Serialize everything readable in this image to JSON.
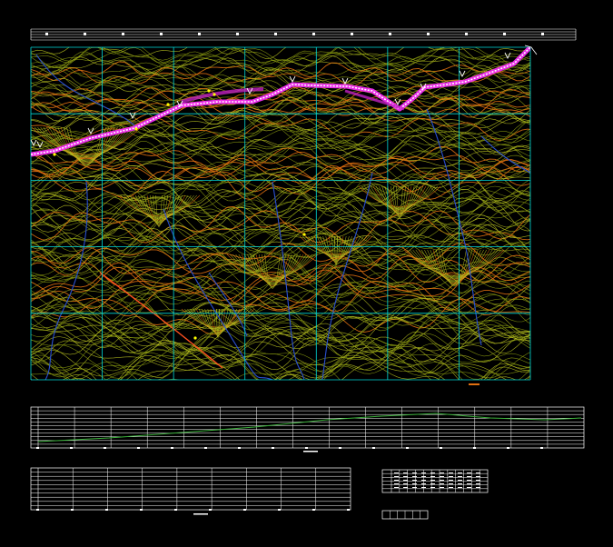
{
  "drawing": {
    "background": "#000000",
    "colors": {
      "contour_main": "#8a9a10",
      "contour_light": "#b8c020",
      "contour_index": "#e07010",
      "river": "#2a50d0",
      "grid": "#00d8d8",
      "road_edge": "#ff30ff",
      "road_center": "#ffffff",
      "station_marker": "#ffff00",
      "profile_lines": "#ffffff",
      "profile_line_green": "#3ab03a"
    },
    "icons": [
      "north-arrow-icon",
      "station-marker-icon"
    ]
  },
  "title_block": {
    "row_count": 4
  },
  "plan": {
    "grid_columns": 7,
    "grid_rows": 5
  },
  "profile_table": {
    "rows": 11,
    "columns": 15
  },
  "section_table": {
    "rows": 10,
    "columns": 9
  },
  "curve_table": {
    "rows": 6,
    "columns": 12
  },
  "legend_box": {
    "cells": 6
  }
}
